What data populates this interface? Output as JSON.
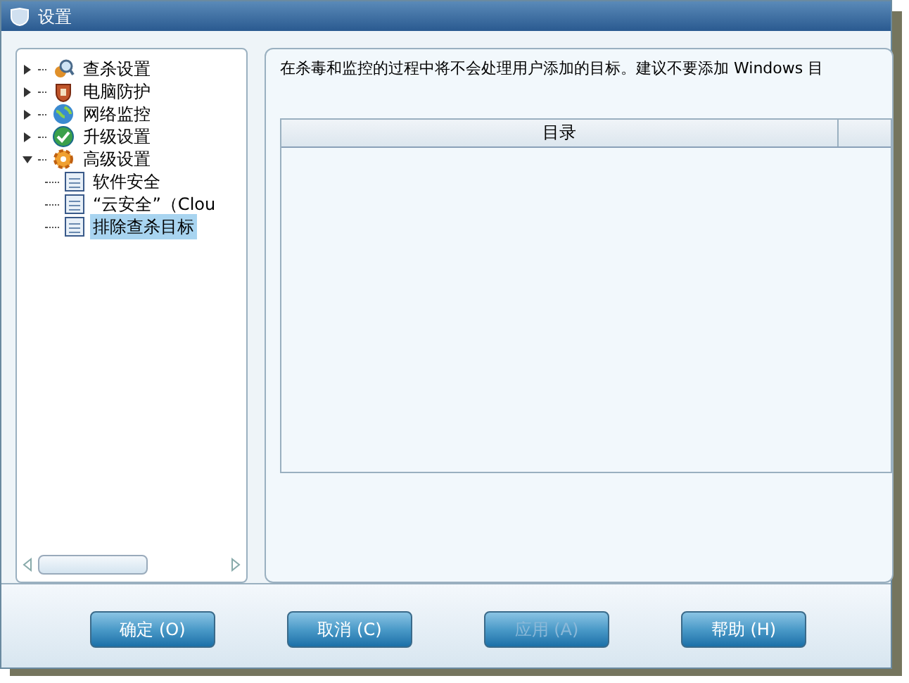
{
  "window": {
    "title": "设置"
  },
  "tree": [
    {
      "label": "查杀设置",
      "expanded": false,
      "selected": false
    },
    {
      "label": "电脑防护",
      "expanded": false,
      "selected": false
    },
    {
      "label": "网络监控",
      "expanded": false,
      "selected": false
    },
    {
      "label": "升级设置",
      "expanded": false,
      "selected": false
    },
    {
      "label": "高级设置",
      "expanded": true,
      "selected": false,
      "children": [
        {
          "label": "软件安全",
          "selected": false
        },
        {
          "label": "“云安全”（Clou",
          "selected": false
        },
        {
          "label": "排除查杀目标",
          "selected": true
        }
      ]
    }
  ],
  "description": "在杀毒和监控的过程中将不会处理用户添加的目标。建议不要添加 Windows 目",
  "table": {
    "columns": [
      "目录"
    ]
  },
  "buttons": [
    {
      "label": "确定 (O)",
      "disabled": false
    },
    {
      "label": "取消 (C)",
      "disabled": false
    },
    {
      "label": "应用 (A)",
      "disabled": true
    },
    {
      "label": "帮助 (H)",
      "disabled": false
    }
  ]
}
